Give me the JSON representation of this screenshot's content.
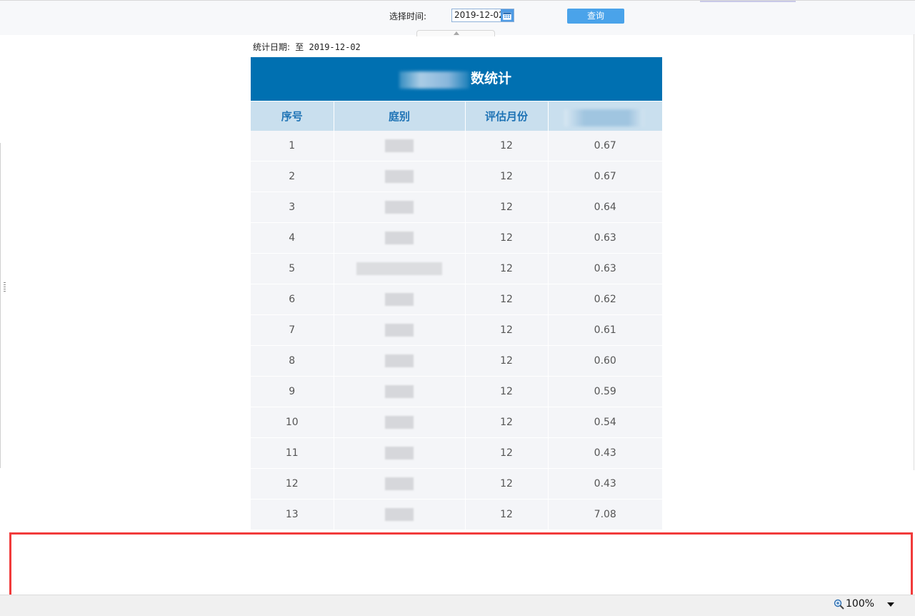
{
  "toolbar": {
    "select_time_label": "选择时间:",
    "date_value": "2019-12-02",
    "query_label": "查询"
  },
  "stat_date": {
    "label": "统计日期:",
    "prefix": "至",
    "value": "2019-12-02"
  },
  "report": {
    "title_suffix": "数统计",
    "headers": [
      "序号",
      "庭别",
      "评估月份"
    ],
    "rows": [
      {
        "no": "1",
        "month": "12",
        "value": "0.67"
      },
      {
        "no": "2",
        "month": "12",
        "value": "0.67"
      },
      {
        "no": "3",
        "month": "12",
        "value": "0.64"
      },
      {
        "no": "4",
        "month": "12",
        "value": "0.63"
      },
      {
        "no": "5",
        "month": "12",
        "value": "0.63"
      },
      {
        "no": "6",
        "month": "12",
        "value": "0.62"
      },
      {
        "no": "7",
        "month": "12",
        "value": "0.61"
      },
      {
        "no": "8",
        "month": "12",
        "value": "0.60"
      },
      {
        "no": "9",
        "month": "12",
        "value": "0.59"
      },
      {
        "no": "10",
        "month": "12",
        "value": "0.54"
      },
      {
        "no": "11",
        "month": "12",
        "value": "0.43"
      },
      {
        "no": "12",
        "month": "12",
        "value": "0.43"
      },
      {
        "no": "13",
        "month": "12",
        "value": "7.08"
      }
    ]
  },
  "status": {
    "zoom": "100%"
  },
  "colors": {
    "header_blue": "#0070b1",
    "column_header_bg": "#c9dfee",
    "query_button": "#4aa3ea",
    "highlight_red": "#f13b3b"
  },
  "icons": {
    "calendar": "calendar-icon",
    "zoom": "magnifier-zoom-icon",
    "dropdown": "chevron-down-icon"
  }
}
